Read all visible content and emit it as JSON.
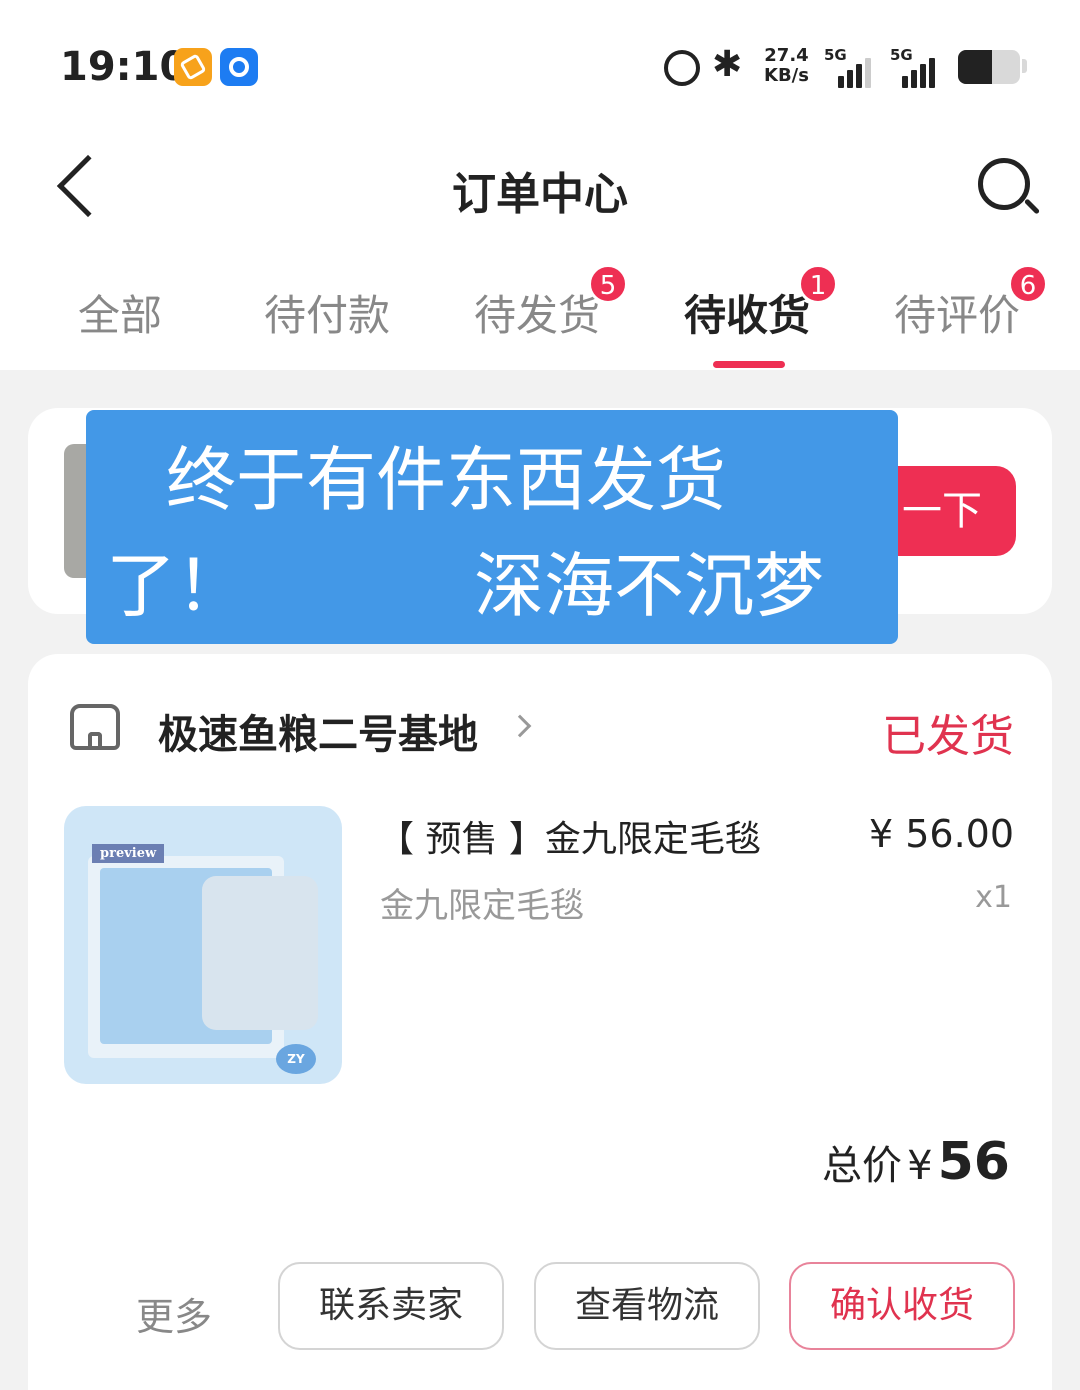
{
  "status_bar": {
    "time": "19:10",
    "net_speed_value": "27.4",
    "net_speed_unit": "KB/s",
    "signal1": "5G",
    "signal2": "5G",
    "battery_level": 0.55,
    "icons": [
      "orange-app-icon",
      "blue-app-icon",
      "alarm-icon",
      "bluetooth-icon",
      "signal-icon",
      "battery-icon"
    ]
  },
  "nav": {
    "title": "订单中心",
    "back_icon": "back-arrow-icon",
    "search_icon": "search-icon"
  },
  "tabs": [
    {
      "label": "全部",
      "badge": ""
    },
    {
      "label": "待付款",
      "badge": ""
    },
    {
      "label": "待发货",
      "badge": "5"
    },
    {
      "label": "待收货",
      "badge": "1",
      "active": true
    },
    {
      "label": "待评价",
      "badge": "6"
    }
  ],
  "banner": {
    "button_label": "一下"
  },
  "caption": {
    "line1": "终于有件东西发货",
    "line2a": "了！",
    "line2b": "深海不沉梦"
  },
  "order": {
    "shop_name": "极速鱼粮二号基地",
    "status": "已发货",
    "product": {
      "title": "【 预售 】金九限定毛毯",
      "spec": "金九限定毛毯",
      "price": "¥ 56.00",
      "qty": "x1",
      "image_label": "preview",
      "image_badge": "ZY"
    },
    "total_label": "总价",
    "total_currency": "¥",
    "total_value": "56",
    "more_label": "更多",
    "actions": [
      "联系卖家",
      "查看物流",
      "确认收货"
    ]
  },
  "colors": {
    "accent": "#ee2f53",
    "caption_bg": "#4398e7",
    "page_bg": "#f2f2f2"
  }
}
